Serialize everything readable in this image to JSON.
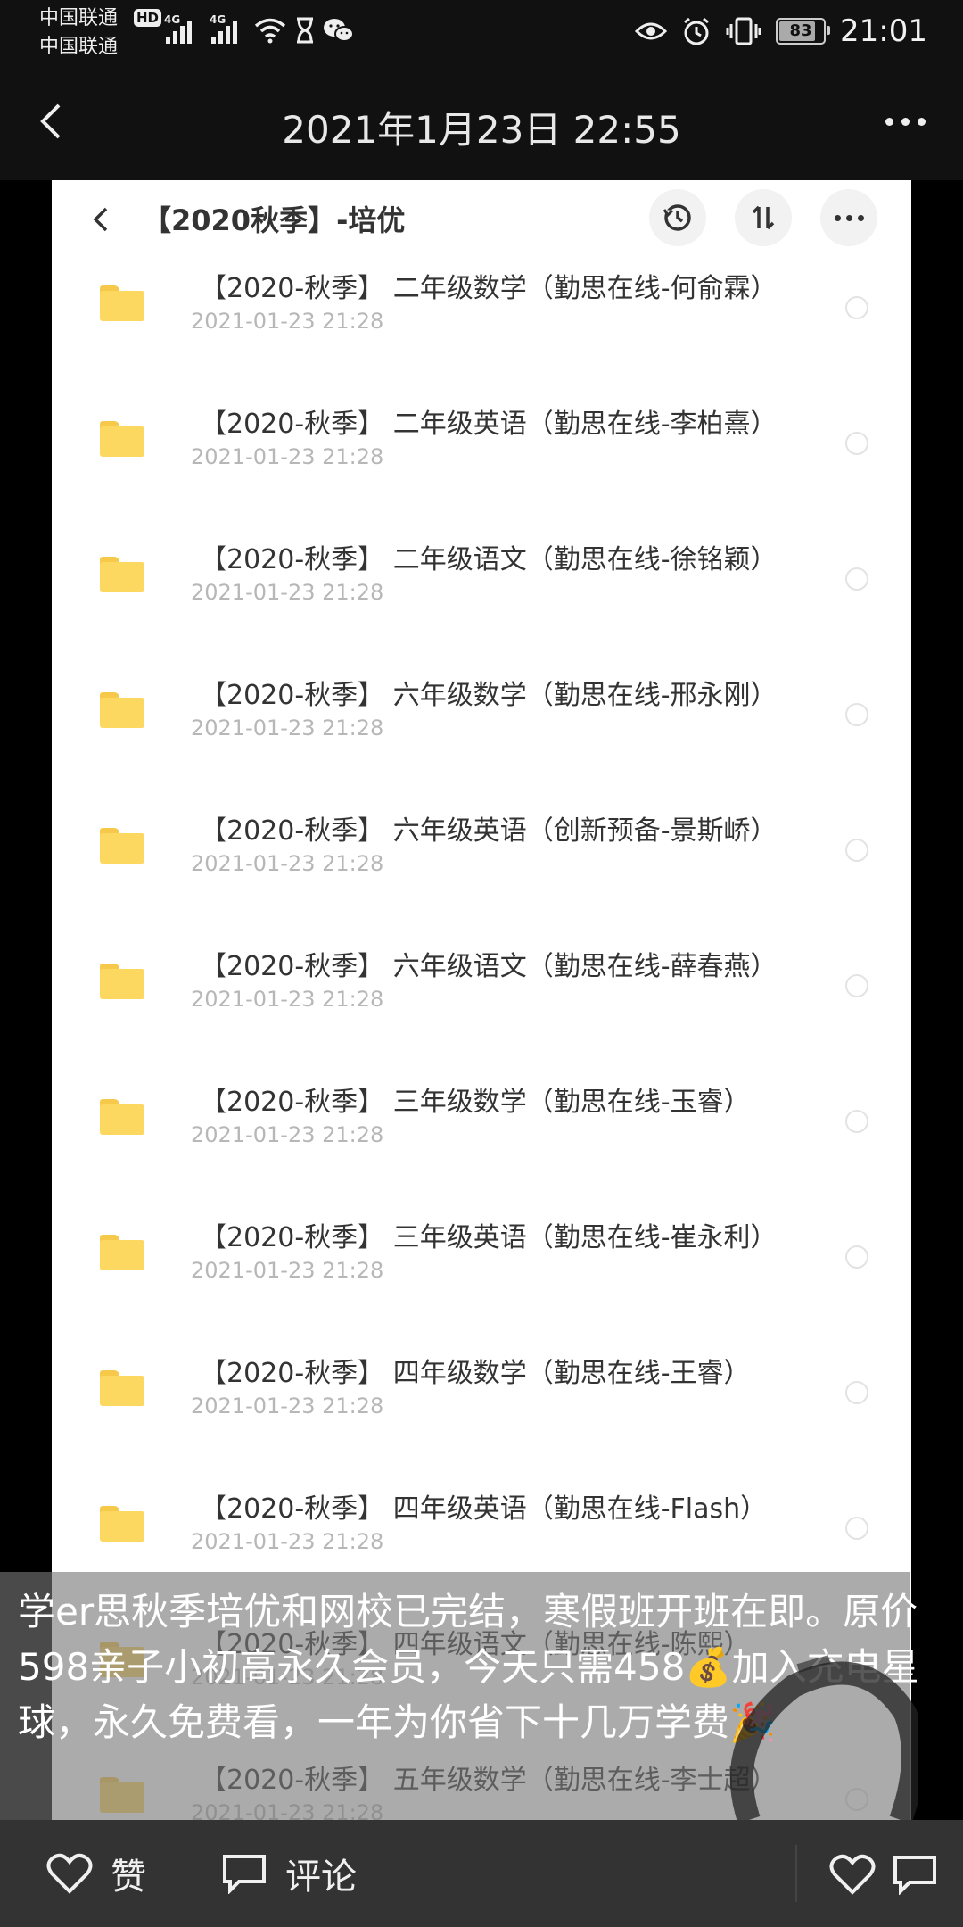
{
  "status_bar": {
    "carrier_1": "中国联通",
    "carrier_2": "中国联通",
    "hd": "HD",
    "net_1": "4G",
    "net_2": "4G",
    "battery": "83",
    "time": "21:01"
  },
  "app_bar": {
    "post_time": "2021年1月23日 22:55"
  },
  "screenshot": {
    "title": "【2020秋季】-培优",
    "items": [
      {
        "name": "【2020-秋季】 二年级数学（勤思在线-何俞霖）",
        "date": "2021-01-23  21:28"
      },
      {
        "name": "【2020-秋季】 二年级英语（勤思在线-李柏熹）",
        "date": "2021-01-23  21:28"
      },
      {
        "name": "【2020-秋季】 二年级语文（勤思在线-徐铭颖）",
        "date": "2021-01-23  21:28"
      },
      {
        "name": "【2020-秋季】 六年级数学（勤思在线-邢永刚）",
        "date": "2021-01-23  21:28"
      },
      {
        "name": "【2020-秋季】 六年级英语（创新预备-景斯峤）",
        "date": "2021-01-23  21:28"
      },
      {
        "name": "【2020-秋季】 六年级语文（勤思在线-薛春燕）",
        "date": "2021-01-23  21:28"
      },
      {
        "name": "【2020-秋季】 三年级数学（勤思在线-玉睿）",
        "date": "2021-01-23  21:28"
      },
      {
        "name": "【2020-秋季】 三年级英语（勤思在线-崔永利）",
        "date": "2021-01-23  21:28"
      },
      {
        "name": "【2020-秋季】 四年级数学（勤思在线-王睿）",
        "date": "2021-01-23  21:28"
      },
      {
        "name": "【2020-秋季】 四年级英语（勤思在线-Flash）",
        "date": "2021-01-23  21:28"
      },
      {
        "name": "【2020-秋季】 四年级语文（勤思在线-陈熙）",
        "date": "2021-01-23  21:28"
      },
      {
        "name": "【2020-秋季】 五年级数学（勤思在线-李士超）",
        "date": "2021-01-23  21:28"
      }
    ]
  },
  "caption": {
    "text": "学er思秋季培优和网校已完结，寒假班开班在即。原价598亲子小初高永久会员，今天只需458💰加入充电星球，永久免费看，一年为你省下十几万学费🎉"
  },
  "bottom_bar": {
    "like_label": "赞",
    "comment_label": "评论"
  },
  "colors": {
    "folder": "#fcd860",
    "caption_bg": "#787878"
  }
}
